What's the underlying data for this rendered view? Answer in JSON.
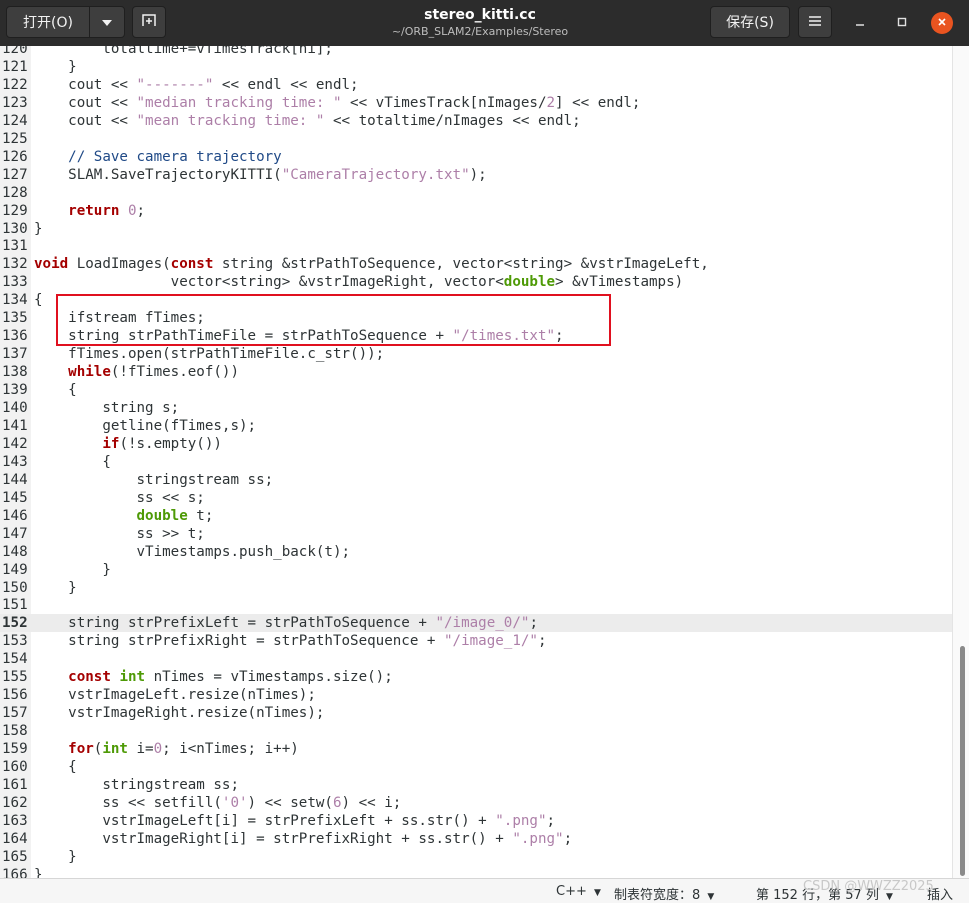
{
  "titlebar": {
    "open_label": "打开(O)",
    "open_dropdown_icon": "chevron-down-icon",
    "new_tab_icon": "new-tab-icon",
    "title": "stereo_kitti.cc",
    "subtitle": "~/ORB_SLAM2/Examples/Stereo",
    "save_label": "保存(S)",
    "menu_icon": "hamburger-menu-icon",
    "minimize_icon": "minimize-icon",
    "maximize_icon": "maximize-icon",
    "close_icon": "close-icon",
    "close_color": "#e95420"
  },
  "editor": {
    "current_line": 152,
    "lines": [
      {
        "n": "120",
        "t": "        totaltime+=vTimesTrack[ni];"
      },
      {
        "n": "121",
        "t": "    }"
      },
      {
        "n": "122",
        "t": "    cout << \"-------\" << endl << endl;"
      },
      {
        "n": "123",
        "t": "    cout << \"median tracking time: \" << vTimesTrack[nImages/2] << endl;"
      },
      {
        "n": "124",
        "t": "    cout << \"mean tracking time: \" << totaltime/nImages << endl;"
      },
      {
        "n": "125",
        "t": ""
      },
      {
        "n": "126",
        "t": "    // Save camera trajectory"
      },
      {
        "n": "127",
        "t": "    SLAM.SaveTrajectoryKITTI(\"CameraTrajectory.txt\");"
      },
      {
        "n": "128",
        "t": ""
      },
      {
        "n": "129",
        "t": "    return 0;"
      },
      {
        "n": "130",
        "t": "}"
      },
      {
        "n": "131",
        "t": ""
      },
      {
        "n": "132",
        "t": "void LoadImages(const string &strPathToSequence, vector<string> &vstrImageLeft,"
      },
      {
        "n": "133",
        "t": "                vector<string> &vstrImageRight, vector<double> &vTimestamps)"
      },
      {
        "n": "134",
        "t": "{"
      },
      {
        "n": "135",
        "t": "    ifstream fTimes;"
      },
      {
        "n": "136",
        "t": "    string strPathTimeFile = strPathToSequence + \"/times.txt\";"
      },
      {
        "n": "137",
        "t": "    fTimes.open(strPathTimeFile.c_str());"
      },
      {
        "n": "138",
        "t": "    while(!fTimes.eof())"
      },
      {
        "n": "139",
        "t": "    {"
      },
      {
        "n": "140",
        "t": "        string s;"
      },
      {
        "n": "141",
        "t": "        getline(fTimes,s);"
      },
      {
        "n": "142",
        "t": "        if(!s.empty())"
      },
      {
        "n": "143",
        "t": "        {"
      },
      {
        "n": "144",
        "t": "            stringstream ss;"
      },
      {
        "n": "145",
        "t": "            ss << s;"
      },
      {
        "n": "146",
        "t": "            double t;"
      },
      {
        "n": "147",
        "t": "            ss >> t;"
      },
      {
        "n": "148",
        "t": "            vTimestamps.push_back(t);"
      },
      {
        "n": "149",
        "t": "        }"
      },
      {
        "n": "150",
        "t": "    }"
      },
      {
        "n": "151",
        "t": ""
      },
      {
        "n": "152",
        "t": "    string strPrefixLeft = strPathToSequence + \"/image_0/\";"
      },
      {
        "n": "153",
        "t": "    string strPrefixRight = strPathToSequence + \"/image_1/\";"
      },
      {
        "n": "154",
        "t": ""
      },
      {
        "n": "155",
        "t": "    const int nTimes = vTimestamps.size();"
      },
      {
        "n": "156",
        "t": "    vstrImageLeft.resize(nTimes);"
      },
      {
        "n": "157",
        "t": "    vstrImageRight.resize(nTimes);"
      },
      {
        "n": "158",
        "t": ""
      },
      {
        "n": "159",
        "t": "    for(int i=0; i<nTimes; i++)"
      },
      {
        "n": "160",
        "t": "    {"
      },
      {
        "n": "161",
        "t": "        stringstream ss;"
      },
      {
        "n": "162",
        "t": "        ss << setfill('0') << setw(6) << i;"
      },
      {
        "n": "163",
        "t": "        vstrImageLeft[i] = strPrefixLeft + ss.str() + \".png\";"
      },
      {
        "n": "164",
        "t": "        vstrImageRight[i] = strPrefixRight + ss.str() + \".png\";"
      },
      {
        "n": "165",
        "t": "    }"
      },
      {
        "n": "166",
        "t": "}"
      }
    ],
    "highlight_color": "#e0101f"
  },
  "statusbar": {
    "language": "C++",
    "tab_width": "制表符宽度：8",
    "position": "第 152 行，第 57 列",
    "insert_mode": "插入",
    "dropdown_icon": "triangle-down-icon"
  },
  "watermark": "CSDN @WWZZ2025"
}
